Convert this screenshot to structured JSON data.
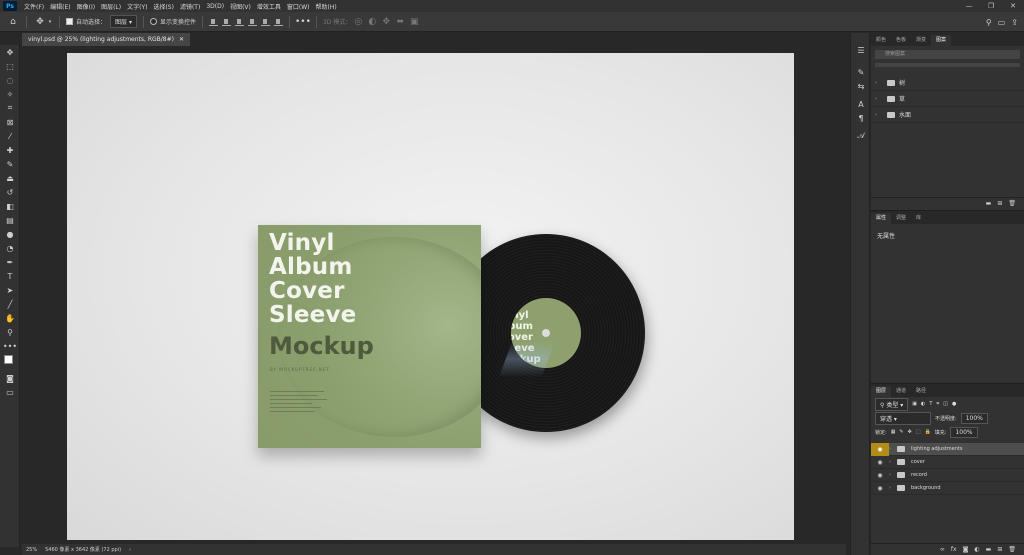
{
  "menubar": {
    "items": [
      "文件(F)",
      "编辑(E)",
      "图像(I)",
      "图层(L)",
      "文字(Y)",
      "选择(S)",
      "滤镜(T)",
      "3D(D)",
      "视图(V)",
      "增效工具",
      "窗口(W)",
      "帮助(H)"
    ]
  },
  "options": {
    "auto_select_label": "自动选择：",
    "auto_select_target": "图层",
    "show_transform_label": "显示变换控件",
    "mode_3d_label": "3D 模式："
  },
  "document": {
    "tab_title": "vinyl.psd @ 25% (lighting adjustments, RGB/8#)",
    "zoom": "25%",
    "doc_info": "5460 像素 x 3642 像素 (72 ppi)"
  },
  "artwork": {
    "title_lines": [
      "Vinyl",
      "Album",
      "Cover",
      "Sleeve"
    ],
    "subtitle": "Mockup",
    "site": "BY MOCKUPFREE.NET",
    "record_label": " Vinyl\nAlbum\n Cover\nSleeve\nMockup"
  },
  "swatches_panel": {
    "tabs": [
      "颜色",
      "色板",
      "渐变",
      "图案"
    ],
    "search_placeholder": "搜索图案",
    "groups": [
      "树",
      "草",
      "水面"
    ]
  },
  "properties_panel": {
    "tabs": [
      "属性",
      "调整",
      "库"
    ],
    "content": "无属性"
  },
  "layers_panel": {
    "tabs": [
      "图层",
      "通道",
      "路径"
    ],
    "filter_label": "类型",
    "blend_mode": "穿透",
    "opacity_label": "不透明度:",
    "opacity_value": "100%",
    "lock_label": "锁定:",
    "fill_label": "填充:",
    "fill_value": "100%",
    "layers": [
      {
        "name": "lighting adjustments",
        "selected": true
      },
      {
        "name": "cover",
        "selected": false
      },
      {
        "name": "record",
        "selected": false
      },
      {
        "name": "background",
        "selected": false
      }
    ]
  }
}
